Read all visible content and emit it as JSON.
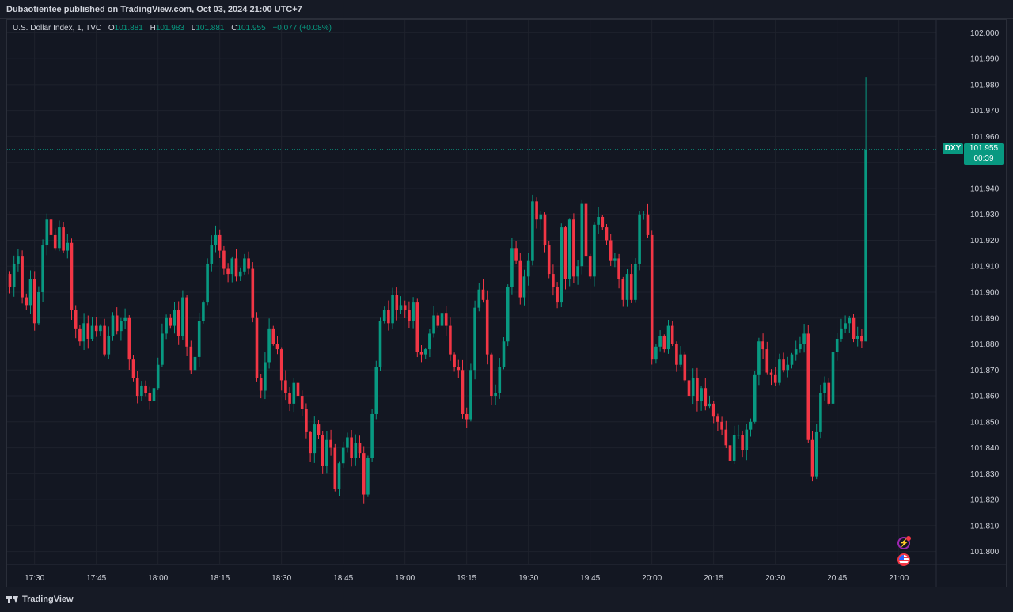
{
  "header": {
    "published": "Dubaotientee published on TradingView.com, Oct 03, 2024 21:00 UTC+7"
  },
  "legend": {
    "symbol": "U.S. Dollar Index, 1, TVC",
    "o_label": "O",
    "o": "101.881",
    "h_label": "H",
    "h": "101.983",
    "l_label": "L",
    "l": "101.881",
    "c_label": "C",
    "c": "101.955",
    "change": "+0.077 (+0.08%)"
  },
  "last_price": {
    "symbol": "DXY",
    "price": "101.955",
    "countdown": "00:39"
  },
  "footer": {
    "brand": "TradingView"
  },
  "colors": {
    "up": "#089981",
    "down": "#f23645",
    "grid": "#1e222d",
    "axis_text": "#d1d4dc"
  },
  "chart_data": {
    "type": "candlestick",
    "ylim": [
      101.795,
      102.005
    ],
    "y_ticks": [
      "101.800",
      "101.810",
      "101.820",
      "101.830",
      "101.840",
      "101.850",
      "101.860",
      "101.870",
      "101.880",
      "101.890",
      "101.900",
      "101.910",
      "101.920",
      "101.930",
      "101.940",
      "101.950",
      "101.960",
      "101.970",
      "101.980",
      "101.990",
      "102.000"
    ],
    "x_ticks": [
      {
        "label": "17:30",
        "idx": 6
      },
      {
        "label": "17:45",
        "idx": 21
      },
      {
        "label": "18:00",
        "idx": 36
      },
      {
        "label": "18:15",
        "idx": 51
      },
      {
        "label": "18:30",
        "idx": 66
      },
      {
        "label": "18:45",
        "idx": 81
      },
      {
        "label": "19:00",
        "idx": 96
      },
      {
        "label": "19:15",
        "idx": 111
      },
      {
        "label": "19:30",
        "idx": 126
      },
      {
        "label": "19:45",
        "idx": 141
      },
      {
        "label": "20:00",
        "idx": 156
      },
      {
        "label": "20:15",
        "idx": 171
      },
      {
        "label": "20:30",
        "idx": 186
      },
      {
        "label": "20:45",
        "idx": 201
      },
      {
        "label": "21:00",
        "idx": 216
      }
    ],
    "close": [
      101.902,
      101.911,
      101.914,
      101.898,
      101.895,
      101.905,
      101.888,
      101.9,
      101.918,
      101.928,
      101.922,
      101.917,
      101.925,
      101.916,
      101.919,
      101.893,
      101.886,
      101.881,
      101.888,
      101.882,
      101.887,
      101.885,
      101.887,
      101.876,
      101.883,
      101.891,
      101.885,
      101.889,
      101.89,
      101.874,
      101.867,
      101.86,
      101.864,
      101.861,
      101.858,
      101.863,
      101.872,
      101.884,
      101.89,
      101.887,
      101.893,
      101.883,
      101.898,
      101.879,
      101.87,
      101.875,
      101.889,
      101.896,
      101.911,
      101.918,
      101.922,
      101.916,
      101.909,
      101.907,
      101.913,
      101.906,
      101.908,
      101.913,
      101.909,
      101.89,
      101.867,
      101.862,
      101.873,
      101.886,
      101.88,
      101.878,
      101.866,
      101.861,
      101.857,
      101.865,
      101.86,
      101.855,
      101.846,
      101.838,
      101.849,
      101.845,
      101.833,
      101.843,
      101.84,
      101.824,
      101.834,
      101.84,
      101.844,
      101.836,
      101.842,
      101.838,
      101.822,
      101.836,
      101.853,
      101.871,
      101.889,
      101.893,
      101.888,
      101.899,
      101.893,
      101.895,
      101.893,
      101.889,
      101.896,
      101.877,
      101.876,
      101.878,
      101.884,
      101.891,
      101.887,
      101.892,
      101.887,
      101.876,
      101.871,
      101.87,
      101.853,
      101.851,
      101.87,
      101.894,
      101.901,
      101.897,
      101.876,
      101.86,
      101.861,
      101.871,
      101.881,
      101.902,
      101.917,
      101.912,
      101.898,
      101.906,
      101.912,
      101.935,
      101.928,
      101.93,
      101.918,
      101.907,
      101.902,
      101.896,
      101.925,
      101.905,
      101.928,
      101.906,
      101.91,
      101.934,
      101.914,
      101.906,
      101.926,
      101.929,
      101.925,
      101.92,
      101.912,
      101.913,
      101.905,
      101.897,
      101.907,
      101.897,
      101.911,
      101.93,
      101.93,
      101.922,
      101.874,
      101.879,
      101.883,
      101.878,
      101.887,
      101.88,
      101.872,
      101.876,
      101.866,
      101.86,
      101.867,
      101.858,
      101.863,
      101.856,
      101.857,
      101.852,
      101.85,
      101.847,
      101.841,
      101.835,
      101.845,
      101.845,
      101.839,
      101.847,
      101.85,
      101.868,
      101.881,
      101.878,
      101.869,
      101.868,
      101.865,
      101.874,
      101.87,
      101.872,
      101.876,
      101.878,
      101.88,
      101.884,
      101.843,
      101.829,
      101.846,
      101.861,
      101.865,
      101.857,
      101.877,
      101.882,
      101.886,
      101.888,
      101.89,
      101.882,
      101.883,
      101.881,
      101.955
    ]
  }
}
